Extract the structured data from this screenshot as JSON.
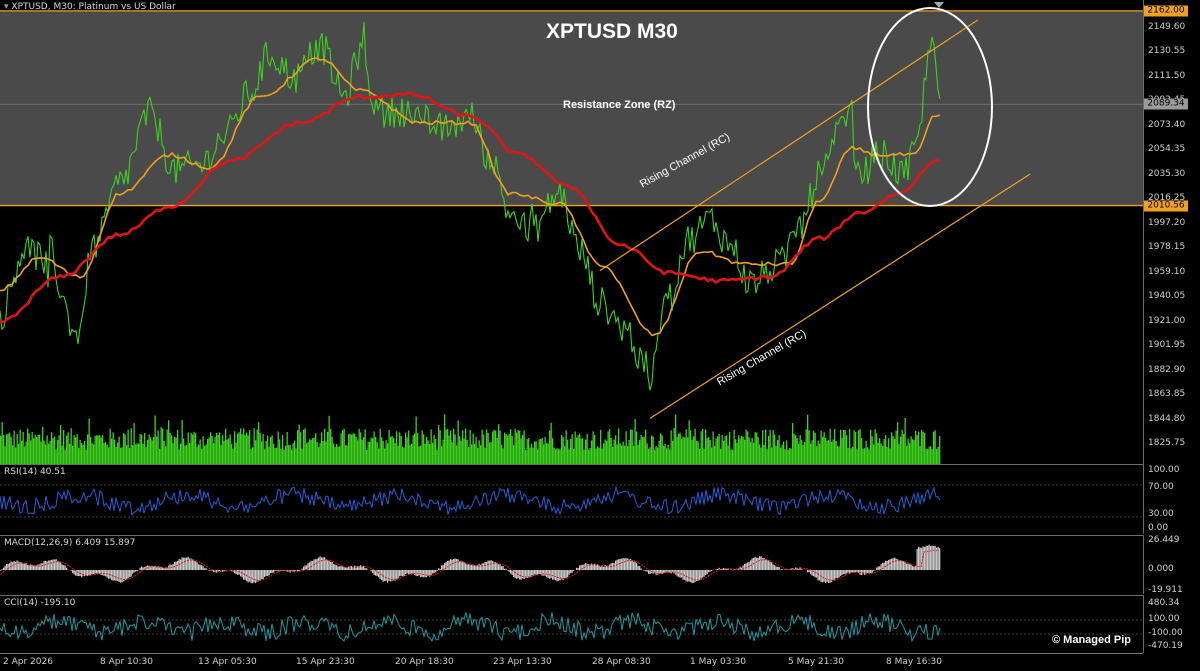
{
  "header": {
    "symbol_info": "XPTUSD, M30:  Platinum vs US Dollar",
    "title": "XPTUSD M30"
  },
  "annotations": {
    "resistance_zone": "Resistance Zone (RZ)",
    "rising_channel_upper": "Rising Channel (RC)",
    "rising_channel_lower": "Rising Channel (RC)",
    "watermark": "© Managed Pip"
  },
  "price_axis": {
    "ticks": [
      "2149.60",
      "2130.55",
      "2111.50",
      "2092.45",
      "2073.40",
      "2054.35",
      "2035.30",
      "2016.25",
      "1997.20",
      "1978.15",
      "1959.10",
      "1940.05",
      "1921.00",
      "1901.95",
      "1882.90",
      "1863.85",
      "1844.80",
      "1825.75"
    ],
    "tags": [
      {
        "label": "2162.00",
        "color": "#f0a020"
      },
      {
        "label": "2089.34",
        "color": "#9a9a9a"
      },
      {
        "label": "2010.56",
        "color": "#f0a020"
      }
    ]
  },
  "rsi": {
    "label": "RSI(14) 40.51",
    "ticks": [
      "100.00",
      "70.00",
      "30.00",
      "0.00"
    ]
  },
  "macd": {
    "label": "MACD(12,26,9) 6.409 15.897",
    "ticks": [
      "26.449",
      "0.000",
      "-19.911"
    ]
  },
  "cci": {
    "label": "CCI(14) -195.10",
    "ticks": [
      "480.34",
      "100.00",
      "-100.00",
      "-470.19"
    ]
  },
  "time_axis": [
    "2 Apr 2026",
    "8 Apr 10:30",
    "13 Apr 05:30",
    "15 Apr 23:30",
    "20 Apr 18:30",
    "23 Apr 13:30",
    "28 Apr 08:30",
    "1 May 03:30",
    "5 May 21:30",
    "8 May 16:30"
  ],
  "colors": {
    "price_line": "#3cd21e",
    "fast_ma": "#f0a020",
    "slow_ma": "#e01515",
    "resistance_zone": "#4a4a4a",
    "channel": "#f0a020",
    "rsi_line": "#1f5fd6",
    "macd_hist": "#c8c8c8",
    "macd_signal": "#e01515",
    "cci_line": "#1a9aa0",
    "volume": "#3cd21e"
  },
  "chart_data": {
    "type": "line",
    "price_anchors": [
      [
        0,
        1925
      ],
      [
        25,
        1978
      ],
      [
        50,
        1965
      ],
      [
        75,
        1915
      ],
      [
        95,
        1980
      ],
      [
        120,
        2028
      ],
      [
        150,
        2082
      ],
      [
        175,
        2038
      ],
      [
        200,
        2042
      ],
      [
        225,
        2065
      ],
      [
        250,
        2098
      ],
      [
        270,
        2128
      ],
      [
        295,
        2110
      ],
      [
        320,
        2135
      ],
      [
        345,
        2095
      ],
      [
        360,
        2130
      ],
      [
        380,
        2080
      ],
      [
        400,
        2085
      ],
      [
        425,
        2074
      ],
      [
        445,
        2070
      ],
      [
        470,
        2080
      ],
      [
        490,
        2048
      ],
      [
        510,
        2005
      ],
      [
        530,
        1990
      ],
      [
        560,
        2020
      ],
      [
        580,
        1975
      ],
      [
        600,
        1935
      ],
      [
        625,
        1915
      ],
      [
        650,
        1873
      ],
      [
        665,
        1935
      ],
      [
        690,
        1985
      ],
      [
        710,
        2000
      ],
      [
        730,
        1980
      ],
      [
        750,
        1950
      ],
      [
        780,
        1965
      ],
      [
        800,
        1995
      ],
      [
        820,
        2035
      ],
      [
        848,
        2080
      ],
      [
        860,
        2035
      ],
      [
        880,
        2050
      ],
      [
        905,
        2035
      ],
      [
        918,
        2060
      ],
      [
        930,
        2140
      ],
      [
        940,
        2095
      ]
    ],
    "fast_ma_anchors": [
      [
        0,
        1945
      ],
      [
        40,
        1970
      ],
      [
        80,
        1955
      ],
      [
        120,
        2020
      ],
      [
        170,
        2050
      ],
      [
        210,
        2040
      ],
      [
        260,
        2095
      ],
      [
        320,
        2125
      ],
      [
        360,
        2100
      ],
      [
        420,
        2075
      ],
      [
        470,
        2075
      ],
      [
        510,
        2020
      ],
      [
        560,
        2012
      ],
      [
        600,
        1965
      ],
      [
        655,
        1910
      ],
      [
        700,
        1975
      ],
      [
        745,
        1965
      ],
      [
        790,
        1965
      ],
      [
        820,
        2015
      ],
      [
        852,
        2055
      ],
      [
        880,
        2050
      ],
      [
        915,
        2050
      ],
      [
        935,
        2080
      ]
    ],
    "slow_ma_anchors": [
      [
        0,
        1920
      ],
      [
        60,
        1955
      ],
      [
        120,
        1988
      ],
      [
        170,
        2010
      ],
      [
        230,
        2045
      ],
      [
        300,
        2075
      ],
      [
        360,
        2095
      ],
      [
        410,
        2097
      ],
      [
        470,
        2080
      ],
      [
        520,
        2050
      ],
      [
        570,
        2025
      ],
      [
        620,
        1980
      ],
      [
        670,
        1958
      ],
      [
        720,
        1952
      ],
      [
        770,
        1955
      ],
      [
        820,
        1985
      ],
      [
        860,
        2005
      ],
      [
        900,
        2020
      ],
      [
        935,
        2045
      ]
    ],
    "ylim": [
      1815,
      2165
    ],
    "resistance_zone": [
      2010.56,
      2162.0
    ],
    "last_price": 2089.34,
    "channel_upper": [
      [
        600,
        1960
      ],
      [
        978,
        2155
      ]
    ],
    "channel_lower": [
      [
        650,
        1845
      ],
      [
        1030,
        2035
      ]
    ]
  }
}
